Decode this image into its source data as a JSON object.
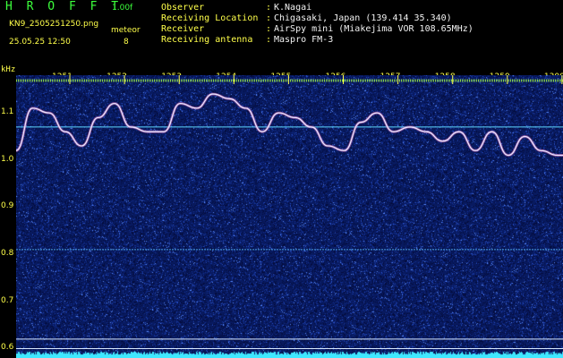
{
  "header": {
    "app_title": "H R O F F T",
    "app_version": "1.00f",
    "file_name": "KN9_2505251250.png",
    "datetime": "25.05.25 12:50",
    "meteor_label": "meteor",
    "meteor_count": "8",
    "info": [
      {
        "label": "Observer",
        "value": "K.Nagai"
      },
      {
        "label": "Receiving Location",
        "value": "Chigasaki, Japan (139.414 35.340)"
      },
      {
        "label": "Receiver",
        "value": "AirSpy mini (Miakejima VOR 108.65MHz)"
      },
      {
        "label": "Receiving antenna",
        "value": "Maspro FM-3"
      }
    ]
  },
  "colors": {
    "text_yellow": "#ffff4a",
    "text_green": "#3cff3c",
    "text_white": "#f2f2f2",
    "noise_bg": "#0a1f6e",
    "trace": "#e6e6ff",
    "bottom_band": "#3fe8ff"
  },
  "chart_data": {
    "type": "heatmap",
    "ylabel": "kHz",
    "x_ticks": [
      "1251",
      "1252",
      "1253",
      "1254",
      "1255",
      "1256",
      "1257",
      "1258",
      "1259",
      "1300"
    ],
    "y_ticks": [
      "1.1",
      "1.0",
      "0.9",
      "0.8",
      "0.7",
      "0.6"
    ],
    "ylim": [
      0.58,
      1.18
    ],
    "xlim": [
      "12:50",
      "13:00"
    ],
    "trace": {
      "x_minutes": [
        0,
        0.3,
        0.6,
        0.9,
        1.2,
        1.5,
        1.8,
        2.1,
        2.4,
        2.7,
        3.0,
        3.3,
        3.6,
        3.9,
        4.2,
        4.5,
        4.8,
        5.1,
        5.4,
        5.7,
        6.0,
        6.3,
        6.6,
        6.9,
        7.2,
        7.5,
        7.8,
        8.1,
        8.4,
        8.7,
        9.0,
        9.3,
        9.6,
        9.9,
        10.0
      ],
      "y_khz": [
        1.02,
        1.11,
        1.1,
        1.06,
        1.03,
        1.09,
        1.12,
        1.07,
        1.06,
        1.06,
        1.12,
        1.11,
        1.14,
        1.13,
        1.11,
        1.06,
        1.1,
        1.09,
        1.07,
        1.03,
        1.02,
        1.08,
        1.1,
        1.06,
        1.07,
        1.06,
        1.04,
        1.06,
        1.02,
        1.06,
        1.01,
        1.05,
        1.02,
        1.01,
        1.01
      ]
    },
    "horizontal_lines_khz": [
      1.07,
      0.81,
      0.62,
      0.6
    ],
    "grid": false
  }
}
